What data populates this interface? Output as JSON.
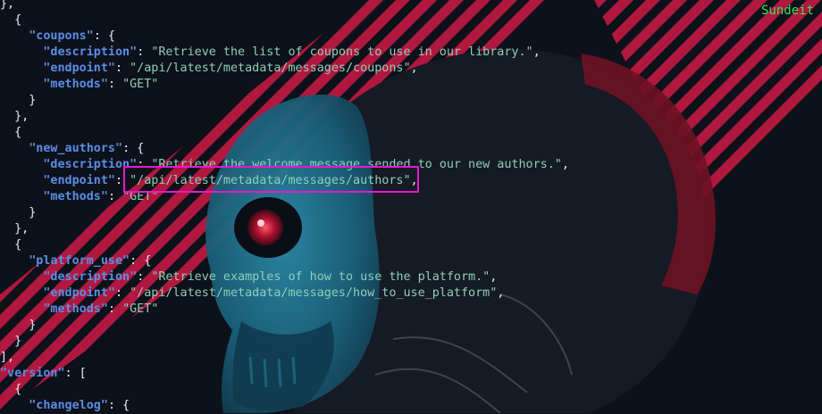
{
  "terminal": {
    "hostname": "Sundeit",
    "lines": [
      [
        {
          "t": "},",
          "c": "p"
        }
      ],
      [
        {
          "t": "  {",
          "c": "p"
        }
      ],
      [
        {
          "t": "    ",
          "c": "p"
        },
        {
          "t": "\"coupons\"",
          "c": "k"
        },
        {
          "t": ": {",
          "c": "p"
        }
      ],
      [
        {
          "t": "      ",
          "c": "p"
        },
        {
          "t": "\"description\"",
          "c": "k"
        },
        {
          "t": ": ",
          "c": "p"
        },
        {
          "t": "\"Retrieve the list of coupons to use in our library.\"",
          "c": "s"
        },
        {
          "t": ",",
          "c": "p"
        }
      ],
      [
        {
          "t": "      ",
          "c": "p"
        },
        {
          "t": "\"endpoint\"",
          "c": "k"
        },
        {
          "t": ": ",
          "c": "p"
        },
        {
          "t": "\"/api/latest/metadata/messages/coupons\"",
          "c": "s"
        },
        {
          "t": ",",
          "c": "p"
        }
      ],
      [
        {
          "t": "      ",
          "c": "p"
        },
        {
          "t": "\"methods\"",
          "c": "k"
        },
        {
          "t": ": ",
          "c": "p"
        },
        {
          "t": "\"GET\"",
          "c": "s"
        }
      ],
      [
        {
          "t": "    }",
          "c": "p"
        }
      ],
      [
        {
          "t": "  },",
          "c": "p"
        }
      ],
      [
        {
          "t": "  {",
          "c": "p"
        }
      ],
      [
        {
          "t": "    ",
          "c": "p"
        },
        {
          "t": "\"new_authors\"",
          "c": "k"
        },
        {
          "t": ": {",
          "c": "p"
        }
      ],
      [
        {
          "t": "      ",
          "c": "p"
        },
        {
          "t": "\"description\"",
          "c": "k"
        },
        {
          "t": ": ",
          "c": "p"
        },
        {
          "t": "\"Retrieve the welcome message sended to our new authors.\"",
          "c": "s"
        },
        {
          "t": ",",
          "c": "p"
        }
      ],
      [
        {
          "t": "      ",
          "c": "p"
        },
        {
          "t": "\"endpoint\"",
          "c": "k"
        },
        {
          "t": ": ",
          "c": "p"
        },
        {
          "t": "\"/api/latest/metadata/messages/authors\"",
          "c": "s"
        },
        {
          "t": ",",
          "c": "p"
        }
      ],
      [
        {
          "t": "      ",
          "c": "p"
        },
        {
          "t": "\"methods\"",
          "c": "k"
        },
        {
          "t": ": ",
          "c": "p"
        },
        {
          "t": "\"GET\"",
          "c": "s"
        }
      ],
      [
        {
          "t": "    }",
          "c": "p"
        }
      ],
      [
        {
          "t": "  },",
          "c": "p"
        }
      ],
      [
        {
          "t": "  {",
          "c": "p"
        }
      ],
      [
        {
          "t": "    ",
          "c": "p"
        },
        {
          "t": "\"platform_use\"",
          "c": "k"
        },
        {
          "t": ": {",
          "c": "p"
        }
      ],
      [
        {
          "t": "      ",
          "c": "p"
        },
        {
          "t": "\"description\"",
          "c": "k"
        },
        {
          "t": ": ",
          "c": "p"
        },
        {
          "t": "\"Retrieve examples of how to use the platform.\"",
          "c": "s"
        },
        {
          "t": ",",
          "c": "p"
        }
      ],
      [
        {
          "t": "      ",
          "c": "p"
        },
        {
          "t": "\"endpoint\"",
          "c": "k"
        },
        {
          "t": ": ",
          "c": "p"
        },
        {
          "t": "\"/api/latest/metadata/messages/how_to_use_platform\"",
          "c": "s"
        },
        {
          "t": ",",
          "c": "p"
        }
      ],
      [
        {
          "t": "      ",
          "c": "p"
        },
        {
          "t": "\"methods\"",
          "c": "k"
        },
        {
          "t": ": ",
          "c": "p"
        },
        {
          "t": "\"GET\"",
          "c": "s"
        }
      ],
      [
        {
          "t": "    }",
          "c": "p"
        }
      ],
      [
        {
          "t": "  }",
          "c": "p"
        }
      ],
      [
        {
          "t": "],",
          "c": "p"
        }
      ],
      [
        {
          "t": "\"version\"",
          "c": "k"
        },
        {
          "t": ": [",
          "c": "p"
        }
      ],
      [
        {
          "t": "  {",
          "c": "p"
        }
      ],
      [
        {
          "t": "    ",
          "c": "p"
        },
        {
          "t": "\"changelog\"",
          "c": "k"
        },
        {
          "t": ": {",
          "c": "p"
        }
      ]
    ]
  },
  "colors": {
    "background": "#0d1119",
    "stripe": "#b0183f",
    "key": "#5b8de6",
    "string": "#8fcfb8",
    "punctuation": "#e8ecf2",
    "hostname": "#36e05a",
    "highlight_border": "#e619d2"
  }
}
